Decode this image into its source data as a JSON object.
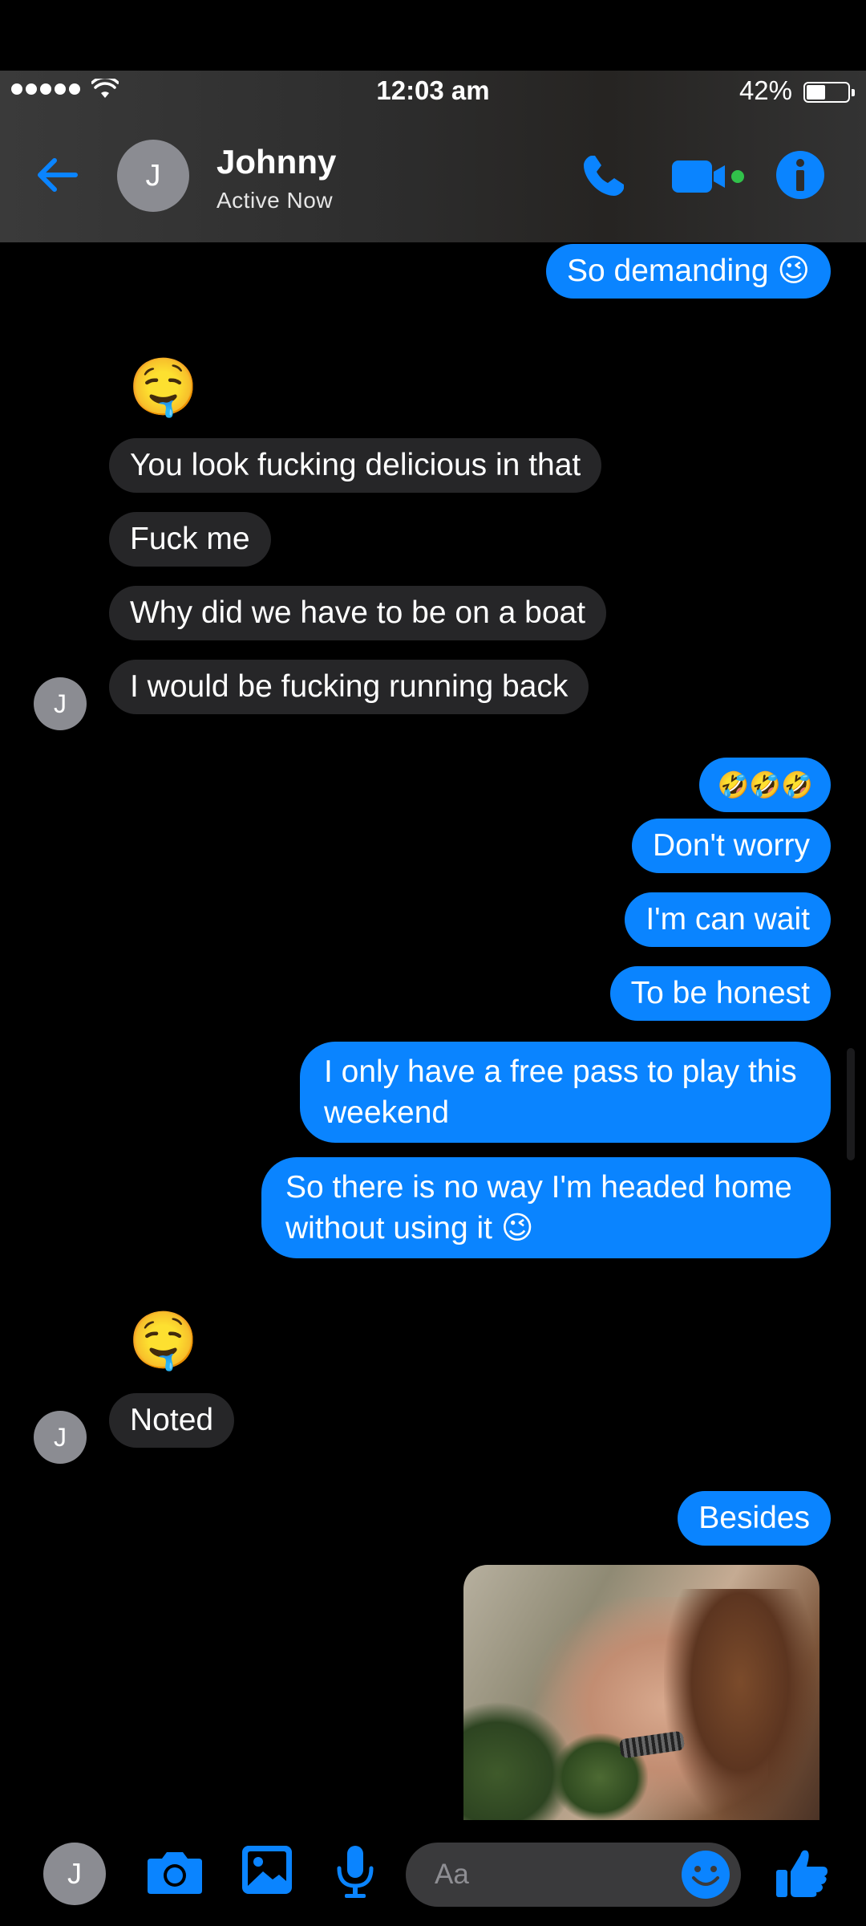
{
  "status_bar": {
    "time": "12:03 am",
    "battery": "42%"
  },
  "header": {
    "avatar_initial": "J",
    "name": "Johnny",
    "status": "Active Now"
  },
  "messages": {
    "m1": "So demanding 😉",
    "m2_emoji": "🤤",
    "m3": "You look fucking delicious in that",
    "m4": "Fuck me",
    "m5": "Why did we have to be on a boat",
    "m6": "I would be fucking running back",
    "m7": "🤣🤣🤣",
    "m8": "Don't worry",
    "m9": "I'm can wait",
    "m10": "To be honest",
    "m11": "I only have a free pass to play this weekend",
    "m12": "So there is no way I'm headed home without using it 😉",
    "m13_emoji": "🤤",
    "m14": "Noted",
    "m15": "Besides"
  },
  "avatars": {
    "initial": "J"
  },
  "composer": {
    "placeholder": "Aa"
  },
  "colors": {
    "accent": "#0a84ff",
    "incoming_bubble": "#262628",
    "background": "#000000"
  },
  "icons": [
    "back-arrow-icon",
    "phone-icon",
    "video-camera-icon",
    "info-icon",
    "camera-icon",
    "gallery-icon",
    "microphone-icon",
    "emoji-icon",
    "thumbs-up-icon"
  ]
}
